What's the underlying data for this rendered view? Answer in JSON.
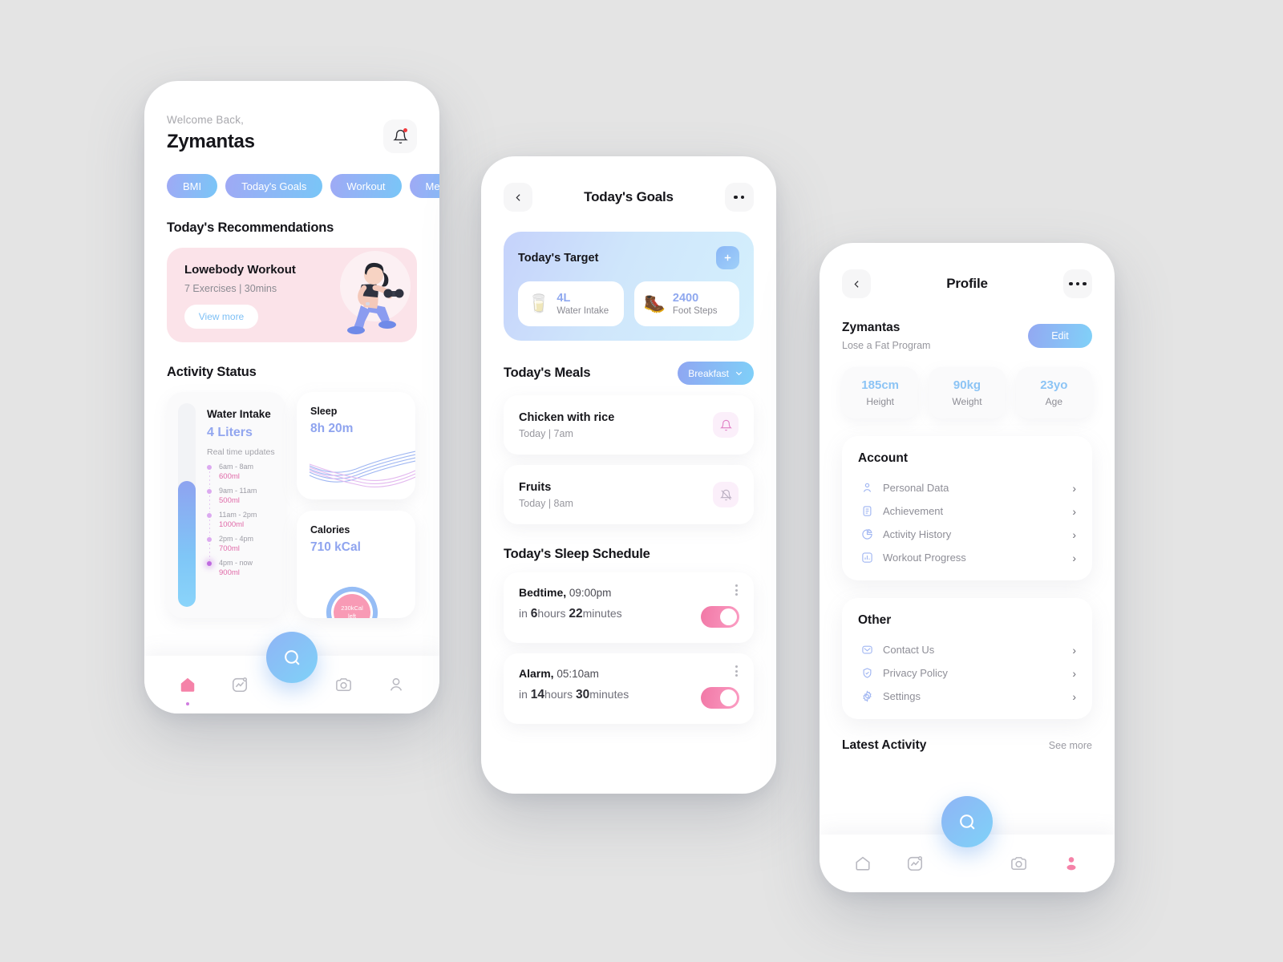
{
  "home": {
    "welcome": "Welcome Back,",
    "username": "Zymantas",
    "bell_icon": "bell-icon",
    "chips": [
      {
        "label": "BMI"
      },
      {
        "label": "Today's Goals"
      },
      {
        "label": "Workout"
      },
      {
        "label": "Meals"
      }
    ],
    "recommendations_title": "Today's Recommendations",
    "recommendation": {
      "title": "Lowebody Workout",
      "meta": "7 Exercises | 30mins",
      "cta": "View more"
    },
    "activity_title": "Activity Status",
    "water": {
      "title": "Water Intake",
      "value": "4 Liters",
      "realtime_label": "Real time updates",
      "fill_percent": 62,
      "entries": [
        {
          "time": "6am - 8am",
          "amount": "600ml"
        },
        {
          "time": "9am - 11am",
          "amount": "500ml"
        },
        {
          "time": "11am - 2pm",
          "amount": "1000ml"
        },
        {
          "time": "2pm - 4pm",
          "amount": "700ml"
        },
        {
          "time": "4pm - now",
          "amount": "900ml"
        }
      ]
    },
    "sleep": {
      "title": "Sleep",
      "hours": "8h",
      "minutes": "20m"
    },
    "calories": {
      "title": "Calories",
      "value": "710 kCal",
      "ring_line1": "230kCal",
      "ring_line2": "left"
    },
    "nav": [
      {
        "icon": "home-icon",
        "active": true
      },
      {
        "icon": "activity-chart-icon",
        "active": false
      },
      {
        "icon": "search-icon",
        "active": false
      },
      {
        "icon": "camera-icon",
        "active": false
      },
      {
        "icon": "profile-icon",
        "active": false
      }
    ]
  },
  "goals": {
    "back_icon": "chevron-left-icon",
    "title": "Today's Goals",
    "more_icon": "more-horizontal-icon",
    "target": {
      "title": "Today's Target",
      "add_icon": "plus-icon",
      "items": [
        {
          "emoji": "🥛",
          "icon_name": "water-glass-icon",
          "value": "4L",
          "label": "Water Intake"
        },
        {
          "emoji": "🥾",
          "icon_name": "boot-icon",
          "value": "2400",
          "label": "Foot Steps"
        }
      ]
    },
    "meals_title": "Today's Meals",
    "meal_filter": "Breakfast",
    "meals": [
      {
        "name": "Chicken with rice",
        "time": "Today | 7am",
        "bell_icon": "bell-on-icon",
        "bell_state": "on"
      },
      {
        "name": "Fruits",
        "time": "Today | 8am",
        "bell_icon": "bell-off-icon",
        "bell_state": "off"
      }
    ],
    "sleep_title": "Today's Sleep Schedule",
    "sleep_items": [
      {
        "label": "Bedtime,",
        "time": "09:00pm",
        "prefix": "in ",
        "num1": "6",
        "mid": "hours ",
        "num2": "22",
        "suffix": "minutes",
        "toggle": true
      },
      {
        "label": "Alarm,",
        "time": "05:10am",
        "prefix": "in ",
        "num1": "14",
        "mid": "hours ",
        "num2": "30",
        "suffix": "minutes",
        "toggle": true
      }
    ]
  },
  "profile": {
    "back_icon": "chevron-left-icon",
    "title": "Profile",
    "more_icon": "more-horizontal-icon",
    "name": "Zymantas",
    "program": "Lose a Fat Program",
    "edit_label": "Edit",
    "stats": [
      {
        "value": "185cm",
        "label": "Height"
      },
      {
        "value": "90kg",
        "label": "Weight"
      },
      {
        "value": "23yo",
        "label": "Age"
      }
    ],
    "account_title": "Account",
    "account_items": [
      {
        "label": "Personal Data",
        "icon": "user-icon"
      },
      {
        "label": "Achievement",
        "icon": "document-icon"
      },
      {
        "label": "Activity History",
        "icon": "pie-chart-icon"
      },
      {
        "label": "Workout Progress",
        "icon": "bar-chart-icon"
      }
    ],
    "other_title": "Other",
    "other_items": [
      {
        "label": "Contact Us",
        "icon": "envelope-icon"
      },
      {
        "label": "Privacy Policy",
        "icon": "shield-check-icon"
      },
      {
        "label": "Settings",
        "icon": "gear-icon"
      }
    ],
    "latest_title": "Latest Activity",
    "see_more": "See more",
    "nav": [
      {
        "icon": "home-icon",
        "active": false
      },
      {
        "icon": "activity-chart-icon",
        "active": false
      },
      {
        "icon": "search-icon",
        "active": false
      },
      {
        "icon": "camera-icon",
        "active": false
      },
      {
        "icon": "profile-icon",
        "active": true
      }
    ]
  },
  "colors": {
    "background": "#e4e4e4",
    "accent_blue": "#8fa8ef",
    "accent_cyan": "#7fd0f8",
    "accent_pink": "#f178a6",
    "card_pink": "#fbe3e9",
    "text_dark": "#15151a",
    "text_muted": "#97979e"
  }
}
